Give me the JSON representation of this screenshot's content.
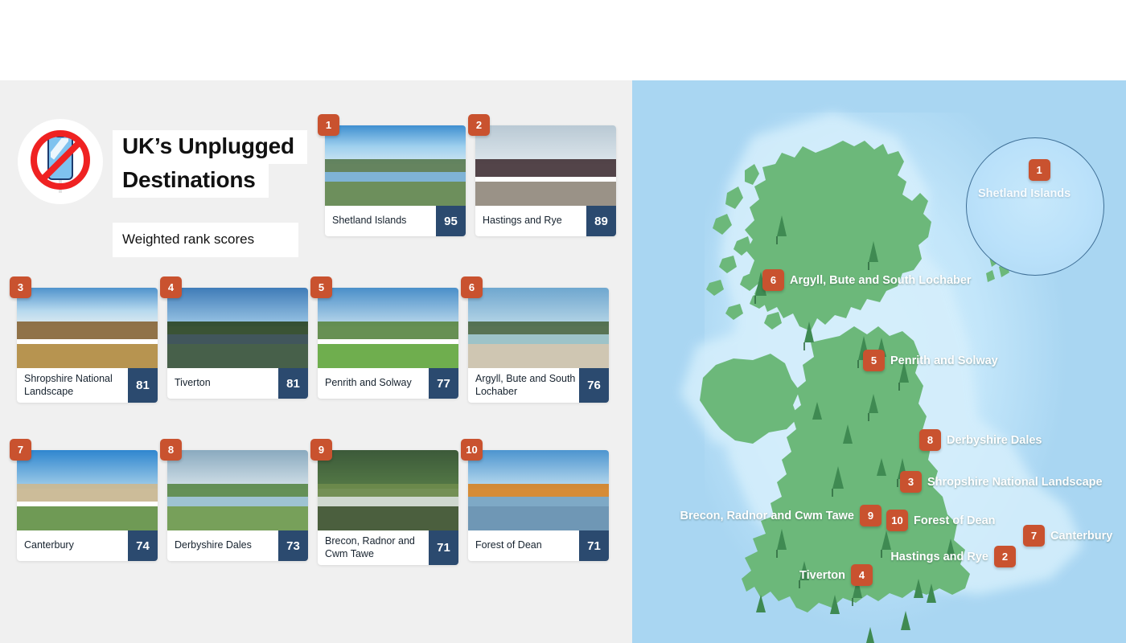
{
  "header": {
    "logo_icon": "no-phone-icon",
    "title_line1": "UK’s Unplugged",
    "title_line2": "Destinations",
    "subtitle": "Weighted rank scores"
  },
  "colors": {
    "panel_background": "#f0f0f0",
    "rank_badge": "#c9522f",
    "score_chip": "#2b4a6f",
    "sea": "#a9d6f2",
    "land": "#6cb87a",
    "card_background": "#ffffff"
  },
  "destinations": [
    {
      "rank": "1",
      "name": "Shetland Islands",
      "score": "95"
    },
    {
      "rank": "2",
      "name": "Hastings and Rye",
      "score": "89"
    },
    {
      "rank": "3",
      "name": "Shropshire National Landscape",
      "score": "81"
    },
    {
      "rank": "4",
      "name": "Tiverton",
      "score": "81"
    },
    {
      "rank": "5",
      "name": "Penrith and Solway",
      "score": "77"
    },
    {
      "rank": "6",
      "name": "Argyll, Bute and South Lochaber",
      "score": "76"
    },
    {
      "rank": "7",
      "name": "Canterbury",
      "score": "74"
    },
    {
      "rank": "8",
      "name": "Derbyshire Dales",
      "score": "73"
    },
    {
      "rank": "9",
      "name": "Brecon, Radnor and Cwm Tawe",
      "score": "71"
    },
    {
      "rank": "10",
      "name": "Forest of Dean",
      "score": "71"
    }
  ],
  "cards": [
    {
      "rank": "1",
      "name": "Shetland Islands",
      "score": "95",
      "image_alt": "coastal-bay-photo"
    },
    {
      "rank": "2",
      "name": "Hastings and Rye",
      "score": "89",
      "image_alt": "churchyard-cross-photo"
    },
    {
      "rank": "3",
      "name": "Shropshire National Landscape",
      "score": "81",
      "image_alt": "hikers-on-hill-photo"
    },
    {
      "rank": "4",
      "name": "Tiverton",
      "score": "81",
      "image_alt": "river-and-willow-photo"
    },
    {
      "rank": "5",
      "name": "Penrith and Solway",
      "score": "77",
      "image_alt": "green-valley-photo"
    },
    {
      "rank": "6",
      "name": "Argyll, Bute and South Lochaber",
      "score": "76",
      "image_alt": "white-sand-beach-photo"
    },
    {
      "rank": "7",
      "name": "Canterbury",
      "score": "74",
      "image_alt": "cathedral-photo"
    },
    {
      "rank": "8",
      "name": "Derbyshire Dales",
      "score": "73",
      "image_alt": "moorland-reservoir-photo"
    },
    {
      "rank": "9",
      "name": "Brecon, Radnor and Cwm Tawe",
      "score": "71",
      "image_alt": "waterfall-photo"
    },
    {
      "rank": "10",
      "name": "Forest of Dean",
      "score": "71",
      "image_alt": "autumn-lake-photo"
    }
  ],
  "map": {
    "inset_label": "Shetland Islands",
    "inset_pin": "1",
    "pins": [
      {
        "num": "6",
        "label": "Argyll, Bute and South Lochaber"
      },
      {
        "num": "5",
        "label": "Penrith and Solway"
      },
      {
        "num": "8",
        "label": "Derbyshire Dales"
      },
      {
        "num": "3",
        "label": "Shropshire National Landscape"
      },
      {
        "num": "9",
        "label": "Brecon, Radnor and Cwm Tawe"
      },
      {
        "num": "10",
        "label": "Forest of Dean"
      },
      {
        "num": "7",
        "label": "Canterbury"
      },
      {
        "num": "2",
        "label": "Hastings and Rye"
      },
      {
        "num": "4",
        "label": "Tiverton"
      }
    ]
  }
}
